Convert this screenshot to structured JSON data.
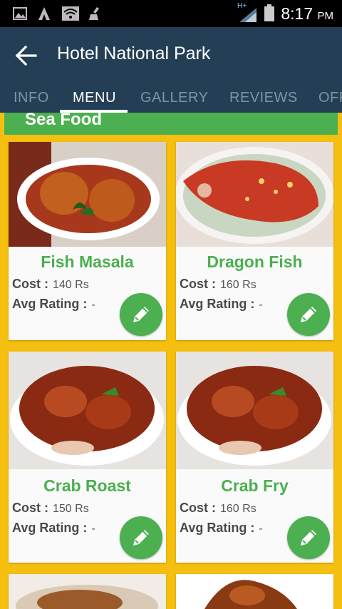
{
  "status_bar": {
    "time": "8:17",
    "ampm": "PM",
    "network": "H+"
  },
  "app_bar": {
    "title": "Hotel National Park"
  },
  "tabs": [
    {
      "label": "INFO",
      "active": false
    },
    {
      "label": "MENU",
      "active": true
    },
    {
      "label": "GALLERY",
      "active": false
    },
    {
      "label": "REVIEWS",
      "active": false
    },
    {
      "label": "OFF",
      "active": false
    }
  ],
  "section": {
    "title": "Sea Food"
  },
  "items": [
    {
      "name": "Fish Masala",
      "cost_label": "Cost :",
      "cost": "140 Rs",
      "rating_label": "Avg Rating :",
      "rating": "-"
    },
    {
      "name": "Dragon Fish",
      "cost_label": "Cost :",
      "cost": "160 Rs",
      "rating_label": "Avg Rating :",
      "rating": "-"
    },
    {
      "name": "Crab Roast",
      "cost_label": "Cost :",
      "cost": "150 Rs",
      "rating_label": "Avg Rating :",
      "rating": "-"
    },
    {
      "name": "Crab Fry",
      "cost_label": "Cost :",
      "cost": "160 Rs",
      "rating_label": "Avg Rating :",
      "rating": "-"
    }
  ],
  "colors": {
    "app_bar": "#243f55",
    "background": "#f5bf0f",
    "accent": "#4caf50"
  }
}
